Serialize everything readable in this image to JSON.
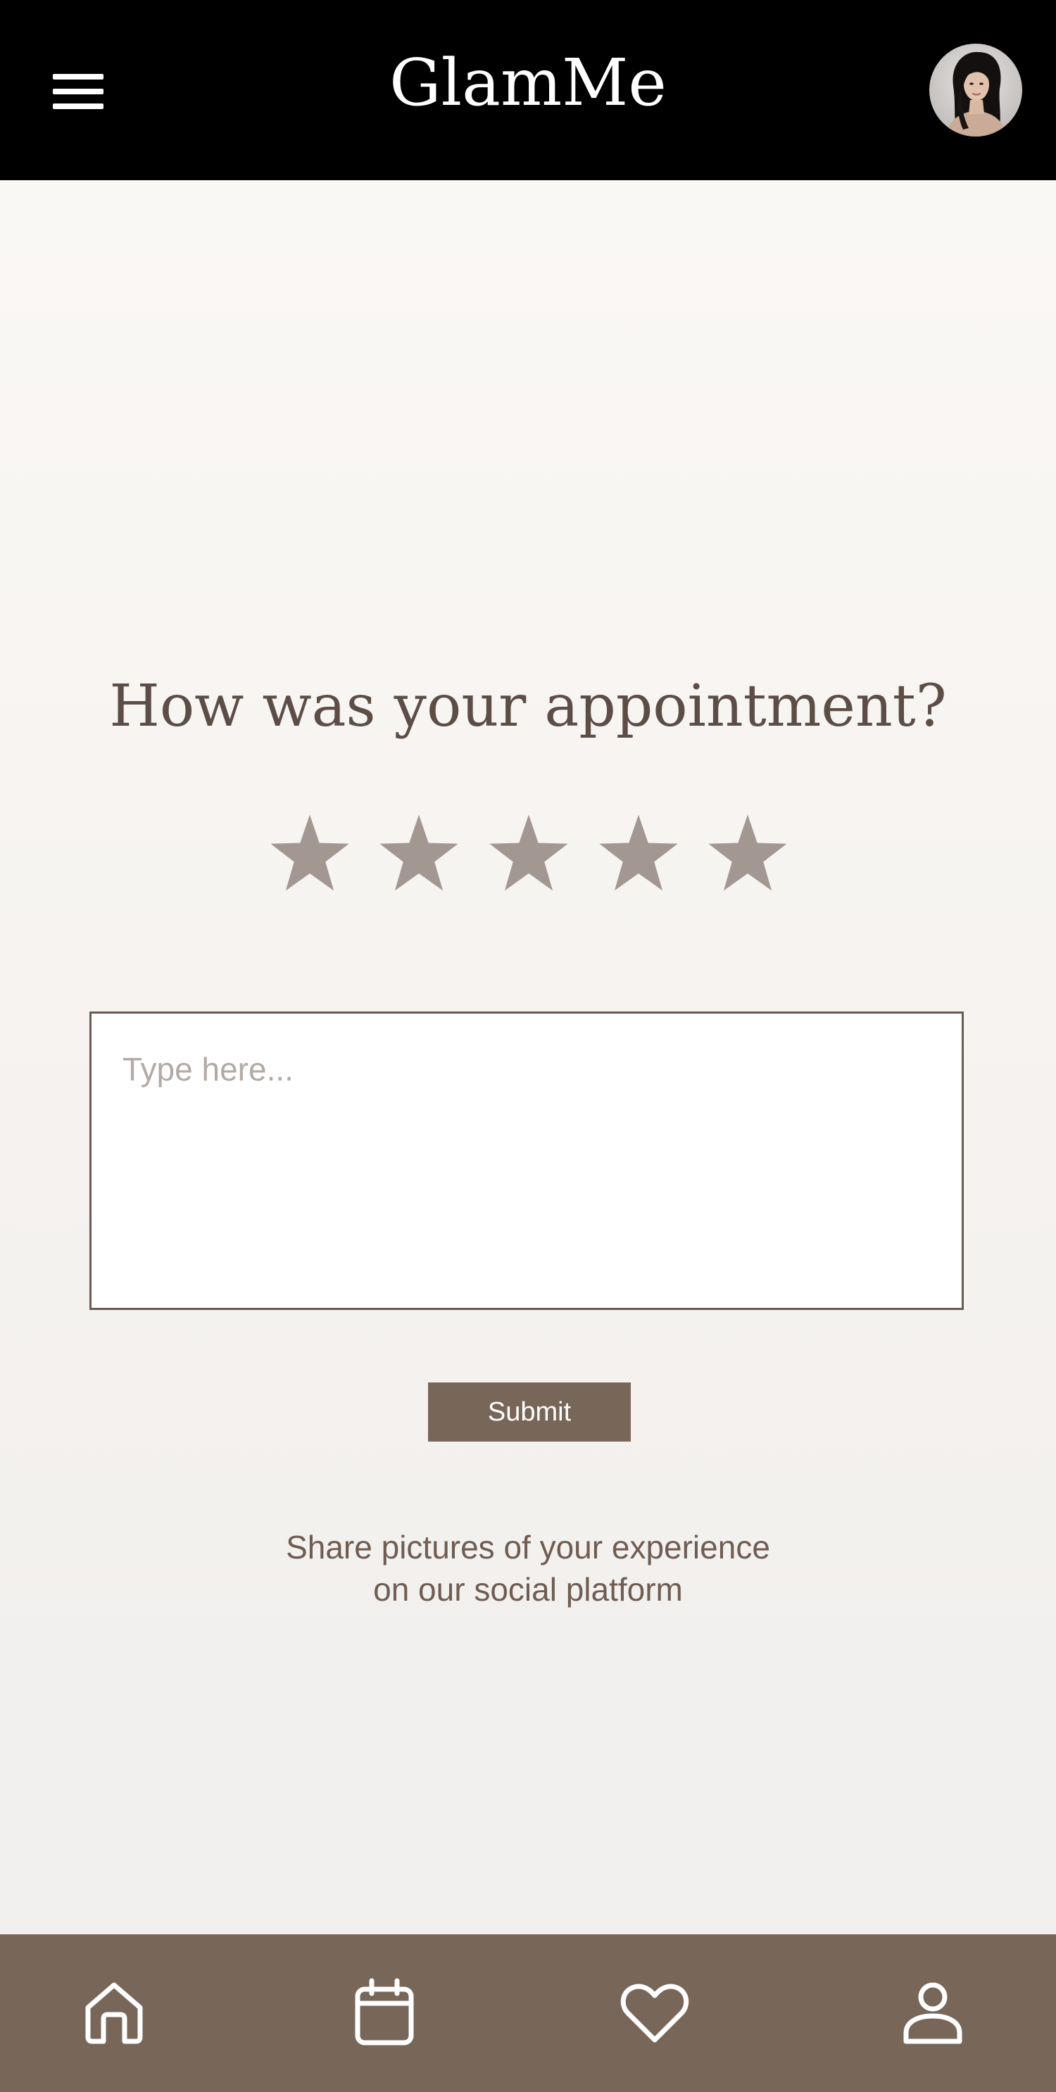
{
  "header": {
    "brand": "GlamMe",
    "menu_icon": "hamburger-menu-icon",
    "avatar": "user-profile-photo"
  },
  "feedback": {
    "prompt": "How was your appointment?",
    "rating": {
      "max_stars": 5,
      "selected": 0,
      "star_color": "#a39891"
    },
    "input": {
      "placeholder": "Type here...",
      "value": ""
    },
    "submit_label": "Submit",
    "share_line1": "Share pictures of your experience",
    "share_line2": "on our social platform"
  },
  "nav": {
    "items": [
      {
        "icon": "home-icon"
      },
      {
        "icon": "calendar-icon"
      },
      {
        "icon": "heart-icon"
      },
      {
        "icon": "profile-icon"
      }
    ]
  },
  "colors": {
    "header_bg": "#000000",
    "accent": "#786659",
    "text": "#5c4e46"
  }
}
